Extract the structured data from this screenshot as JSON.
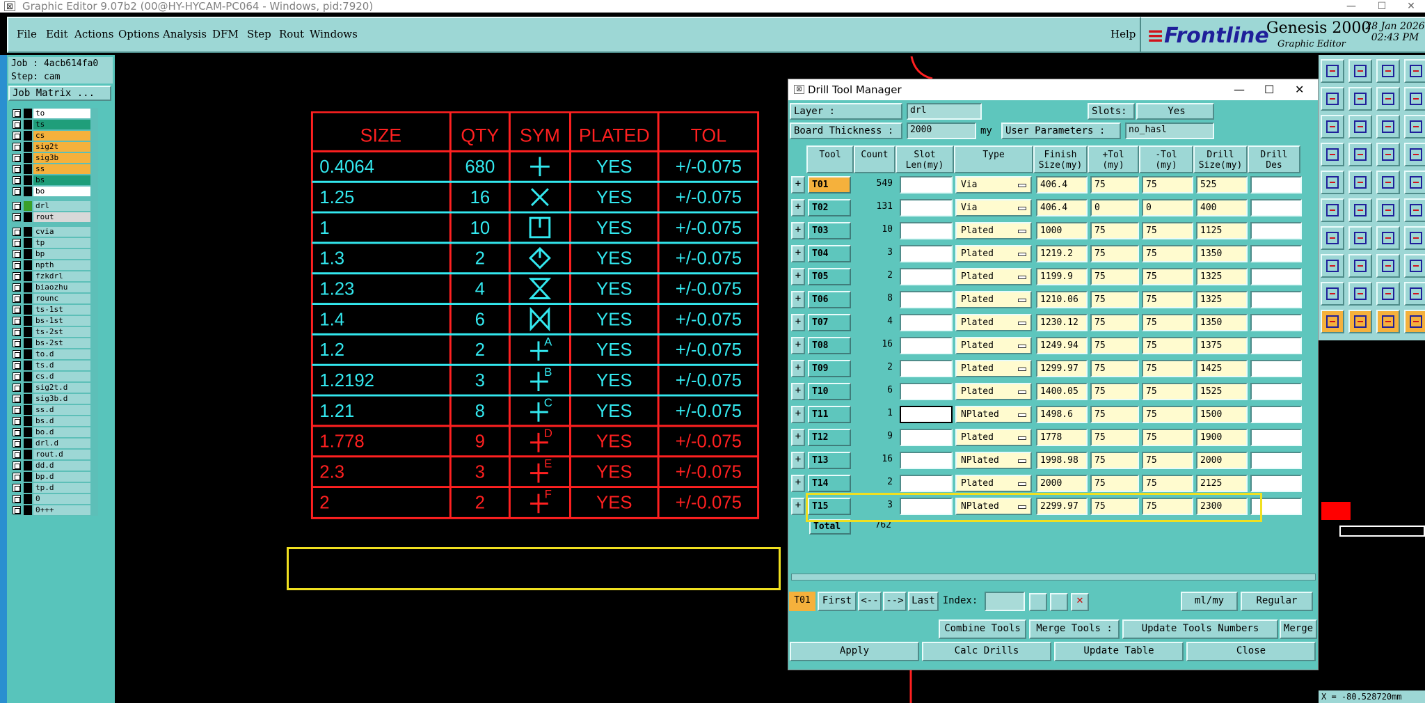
{
  "window": {
    "title": "Graphic Editor 9.07b2 (00@HY-HYCAM-PC064 - Windows, pid:7920)",
    "min": "—",
    "max": "☐",
    "close": "✕"
  },
  "menu": [
    "File",
    "Edit",
    "Actions",
    "Options",
    "Analysis",
    "DFM",
    "Step",
    "Rout",
    "Windows"
  ],
  "help": "Help",
  "brand": {
    "name": "Frontline",
    "product": "Genesis 2000",
    "sub": "Graphic Editor",
    "date": "28 Jan 2026",
    "time": "02:43 PM"
  },
  "job": {
    "job": "Job : 4acb614fa0",
    "step": "Step: cam",
    "matrix_btn": "Job Matrix ..."
  },
  "layers": [
    {
      "name": "to",
      "color": "#ffffff",
      "swatch": "#000000"
    },
    {
      "name": "ts",
      "color": "#1f9e7a",
      "swatch": "#000000"
    },
    {
      "name": "cs",
      "color": "#f5b13c",
      "swatch": "#000000"
    },
    {
      "name": "sig2t",
      "color": "#f5b13c",
      "swatch": "#000000"
    },
    {
      "name": "sig3b",
      "color": "#f5b13c",
      "swatch": "#000000"
    },
    {
      "name": "ss",
      "color": "#f5b13c",
      "swatch": "#000000"
    },
    {
      "name": "bs",
      "color": "#1f9e7a",
      "swatch": "#000000"
    },
    {
      "name": "bo",
      "color": "#ffffff",
      "swatch": "#000000"
    },
    {
      "sep": true
    },
    {
      "name": "drl",
      "color": "#9dd7d5",
      "swatch": "#3aa02a"
    },
    {
      "name": "rout",
      "color": "#d8d8d8",
      "swatch": "#000000"
    },
    {
      "sep": true
    },
    {
      "name": "cvia",
      "color": "#9dd7d5",
      "swatch": "#000000"
    },
    {
      "name": "tp",
      "color": "#9dd7d5",
      "swatch": "#000000"
    },
    {
      "name": "bp",
      "color": "#9dd7d5",
      "swatch": "#000000"
    },
    {
      "name": "npth",
      "color": "#9dd7d5",
      "swatch": "#000000"
    },
    {
      "name": "fzkdrl",
      "color": "#9dd7d5",
      "swatch": "#000000"
    },
    {
      "name": "biaozhu",
      "color": "#9dd7d5",
      "swatch": "#000000"
    },
    {
      "name": "rounc",
      "color": "#9dd7d5",
      "swatch": "#000000"
    },
    {
      "name": "ts-1st",
      "color": "#9dd7d5",
      "swatch": "#000000"
    },
    {
      "name": "bs-1st",
      "color": "#9dd7d5",
      "swatch": "#000000"
    },
    {
      "name": "ts-2st",
      "color": "#9dd7d5",
      "swatch": "#000000"
    },
    {
      "name": "bs-2st",
      "color": "#9dd7d5",
      "swatch": "#000000"
    },
    {
      "name": "to.d",
      "color": "#9dd7d5",
      "swatch": "#000000"
    },
    {
      "name": "ts.d",
      "color": "#9dd7d5",
      "swatch": "#000000"
    },
    {
      "name": "cs.d",
      "color": "#9dd7d5",
      "swatch": "#000000"
    },
    {
      "name": "sig2t.d",
      "color": "#9dd7d5",
      "swatch": "#000000"
    },
    {
      "name": "sig3b.d",
      "color": "#9dd7d5",
      "swatch": "#000000"
    },
    {
      "name": "ss.d",
      "color": "#9dd7d5",
      "swatch": "#000000"
    },
    {
      "name": "bs.d",
      "color": "#9dd7d5",
      "swatch": "#000000"
    },
    {
      "name": "bo.d",
      "color": "#9dd7d5",
      "swatch": "#000000"
    },
    {
      "name": "drl.d",
      "color": "#9dd7d5",
      "swatch": "#000000"
    },
    {
      "name": "rout.d",
      "color": "#9dd7d5",
      "swatch": "#000000"
    },
    {
      "name": "dd.d",
      "color": "#9dd7d5",
      "swatch": "#000000"
    },
    {
      "name": "bp.d",
      "color": "#9dd7d5",
      "swatch": "#000000"
    },
    {
      "name": "tp.d",
      "color": "#9dd7d5",
      "swatch": "#000000"
    },
    {
      "name": "0",
      "color": "#9dd7d5",
      "swatch": "#000000"
    },
    {
      "name": "0+++",
      "color": "#9dd7d5",
      "swatch": "#000000"
    }
  ],
  "drill_table": {
    "headers": [
      "SIZE",
      "QTY",
      "SYM",
      "PLATED",
      "TOL"
    ],
    "rows": [
      {
        "size": "0.4064",
        "qty": "680",
        "sym": "plus",
        "plated": "YES",
        "tol": "+/-0.075",
        "color": "#33e8ef"
      },
      {
        "size": "1.25",
        "qty": "16",
        "sym": "x",
        "plated": "YES",
        "tol": "+/-0.075",
        "color": "#33e8ef"
      },
      {
        "size": "1",
        "qty": "10",
        "sym": "box",
        "plated": "YES",
        "tol": "+/-0.075",
        "color": "#33e8ef"
      },
      {
        "size": "1.3",
        "qty": "2",
        "sym": "diamond",
        "plated": "YES",
        "tol": "+/-0.075",
        "color": "#33e8ef"
      },
      {
        "size": "1.23",
        "qty": "4",
        "sym": "hourglass",
        "plated": "YES",
        "tol": "+/-0.075",
        "color": "#33e8ef"
      },
      {
        "size": "1.4",
        "qty": "6",
        "sym": "bowtie",
        "plated": "YES",
        "tol": "+/-0.075",
        "color": "#33e8ef"
      },
      {
        "size": "1.2",
        "qty": "2",
        "sym": "A",
        "plated": "YES",
        "tol": "+/-0.075",
        "color": "#33e8ef"
      },
      {
        "size": "1.2192",
        "qty": "3",
        "sym": "B",
        "plated": "YES",
        "tol": "+/-0.075",
        "color": "#33e8ef"
      },
      {
        "size": "1.21",
        "qty": "8",
        "sym": "C",
        "plated": "YES",
        "tol": "+/-0.075",
        "color": "#33e8ef"
      },
      {
        "size": "1.778",
        "qty": "9",
        "sym": "D",
        "plated": "YES",
        "tol": "+/-0.075",
        "color": "#ff2020"
      },
      {
        "size": "2.3",
        "qty": "3",
        "sym": "E",
        "plated": "YES",
        "tol": "+/-0.075",
        "color": "#ff2020"
      },
      {
        "size": "2",
        "qty": "2",
        "sym": "F",
        "plated": "YES",
        "tol": "+/-0.075",
        "color": "#ff2020"
      }
    ]
  },
  "dtm": {
    "title": "Drill Tool Manager",
    "layer_label": "Layer            :",
    "layer_value": "drl",
    "slots_label": "Slots:",
    "slots_value": "Yes",
    "thick_label": "Board Thickness :",
    "thick_value": "2000",
    "thick_unit": "my",
    "userp_label": "User Parameters :",
    "userp_value": "no_hasl",
    "cols": [
      "Tool",
      "Count",
      "Slot\nLen(my)",
      "Type",
      "Finish\nSize(my)",
      "+Tol\n(my)",
      "-Tol\n(my)",
      "Drill\nSize(my)",
      "Drill\nDes"
    ],
    "tools": [
      {
        "tool": "T01",
        "count": "549",
        "type": "Via",
        "finish": "406.4",
        "ptol": "75",
        "mtol": "75",
        "drill": "525"
      },
      {
        "tool": "T02",
        "count": "131",
        "type": "Via",
        "finish": "406.4",
        "ptol": "0",
        "mtol": "0",
        "drill": "400"
      },
      {
        "tool": "T03",
        "count": "10",
        "type": "Plated",
        "finish": "1000",
        "ptol": "75",
        "mtol": "75",
        "drill": "1125"
      },
      {
        "tool": "T04",
        "count": "3",
        "type": "Plated",
        "finish": "1219.2",
        "ptol": "75",
        "mtol": "75",
        "drill": "1350"
      },
      {
        "tool": "T05",
        "count": "2",
        "type": "Plated",
        "finish": "1199.9",
        "ptol": "75",
        "mtol": "75",
        "drill": "1325"
      },
      {
        "tool": "T06",
        "count": "8",
        "type": "Plated",
        "finish": "1210.06",
        "ptol": "75",
        "mtol": "75",
        "drill": "1325"
      },
      {
        "tool": "T07",
        "count": "4",
        "type": "Plated",
        "finish": "1230.12",
        "ptol": "75",
        "mtol": "75",
        "drill": "1350"
      },
      {
        "tool": "T08",
        "count": "16",
        "type": "Plated",
        "finish": "1249.94",
        "ptol": "75",
        "mtol": "75",
        "drill": "1375"
      },
      {
        "tool": "T09",
        "count": "2",
        "type": "Plated",
        "finish": "1299.97",
        "ptol": "75",
        "mtol": "75",
        "drill": "1425"
      },
      {
        "tool": "T10",
        "count": "6",
        "type": "Plated",
        "finish": "1400.05",
        "ptol": "75",
        "mtol": "75",
        "drill": "1525"
      },
      {
        "tool": "T11",
        "count": "1",
        "type": "NPlated",
        "finish": "1498.6",
        "ptol": "75",
        "mtol": "75",
        "drill": "1500"
      },
      {
        "tool": "T12",
        "count": "9",
        "type": "Plated",
        "finish": "1778",
        "ptol": "75",
        "mtol": "75",
        "drill": "1900"
      },
      {
        "tool": "T13",
        "count": "16",
        "type": "NPlated",
        "finish": "1998.98",
        "ptol": "75",
        "mtol": "75",
        "drill": "2000"
      },
      {
        "tool": "T14",
        "count": "2",
        "type": "Plated",
        "finish": "2000",
        "ptol": "75",
        "mtol": "75",
        "drill": "2125"
      },
      {
        "tool": "T15",
        "count": "3",
        "type": "NPlated",
        "finish": "2299.97",
        "ptol": "75",
        "mtol": "75",
        "drill": "2300"
      }
    ],
    "total_label": "Total",
    "total_value": "762",
    "nav": {
      "current": "T01",
      "first": "First",
      "prev": "<--",
      "next": "-->",
      "last": "Last",
      "index_label": "Index:",
      "units": "ml/my",
      "mode": "Regular"
    },
    "actions": {
      "combine": "Combine Tools",
      "merge": "Merge Tools :",
      "update_num": "Update Tools Numbers",
      "merge2": "Merge"
    },
    "bottom": {
      "apply": "Apply",
      "calc": "Calc Drills",
      "update": "Update Table",
      "close": "Close"
    }
  },
  "status": "X = -80.528720mm"
}
